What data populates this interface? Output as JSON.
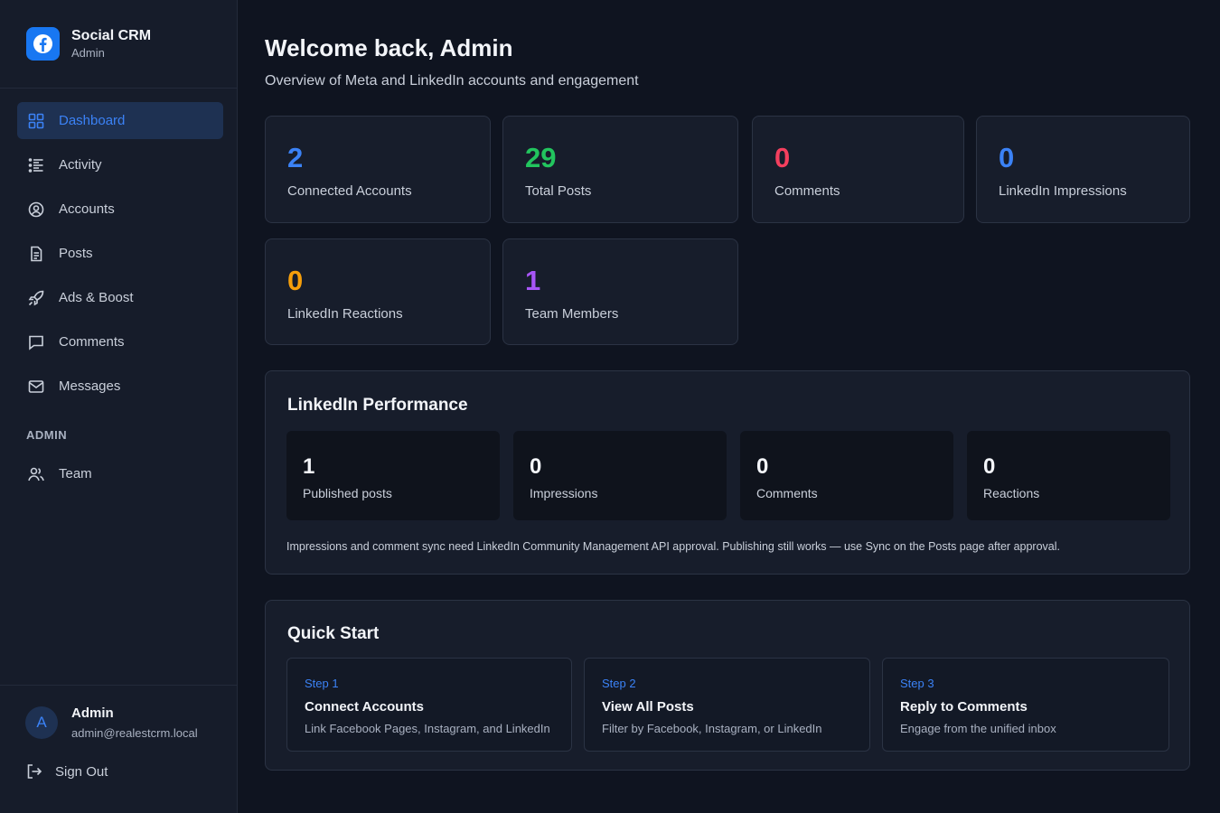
{
  "sidebar": {
    "brand_title": "Social CRM",
    "brand_sub": "Admin",
    "nav": [
      {
        "label": "Dashboard",
        "icon": "grid-icon",
        "active": true
      },
      {
        "label": "Activity",
        "icon": "list-icon"
      },
      {
        "label": "Accounts",
        "icon": "accounts-icon"
      },
      {
        "label": "Posts",
        "icon": "document-icon"
      },
      {
        "label": "Ads & Boost",
        "icon": "rocket-icon"
      },
      {
        "label": "Comments",
        "icon": "comment-icon"
      },
      {
        "label": "Messages",
        "icon": "mail-icon"
      }
    ],
    "admin_section": "ADMIN",
    "team_label": "Team",
    "user": {
      "initial": "A",
      "name": "Admin",
      "email": "admin@realestcrm.local"
    },
    "signout_label": "Sign Out"
  },
  "header": {
    "title": "Welcome back, Admin",
    "subtitle": "Overview of Meta and LinkedIn accounts and engagement"
  },
  "stats": [
    {
      "value": "2",
      "label": "Connected Accounts",
      "color": "#3b82f6"
    },
    {
      "value": "29",
      "label": "Total Posts",
      "color": "#22c55e"
    },
    {
      "value": "0",
      "label": "Comments",
      "color": "#f43f5e"
    },
    {
      "value": "0",
      "label": "LinkedIn Impressions",
      "color": "#3b82f6"
    },
    {
      "value": "0",
      "label": "LinkedIn Reactions",
      "color": "#f59e0b"
    },
    {
      "value": "1",
      "label": "Team Members",
      "color": "#a855f7"
    }
  ],
  "linkedin": {
    "title": "LinkedIn Performance",
    "cards": [
      {
        "value": "1",
        "label": "Published posts"
      },
      {
        "value": "0",
        "label": "Impressions"
      },
      {
        "value": "0",
        "label": "Comments"
      },
      {
        "value": "0",
        "label": "Reactions"
      }
    ],
    "note": "Impressions and comment sync need LinkedIn Community Management API approval. Publishing still works  — use Sync on the Posts page after approval."
  },
  "quickstart": {
    "title": "Quick Start",
    "steps": [
      {
        "step": "Step 1",
        "title": "Connect Accounts",
        "desc": "Link Facebook Pages, Instagram, and LinkedIn"
      },
      {
        "step": "Step 2",
        "title": "View All Posts",
        "desc": "Filter by Facebook, Instagram, or LinkedIn"
      },
      {
        "step": "Step 3",
        "title": "Reply to Comments",
        "desc": "Engage from the unified inbox"
      }
    ]
  }
}
